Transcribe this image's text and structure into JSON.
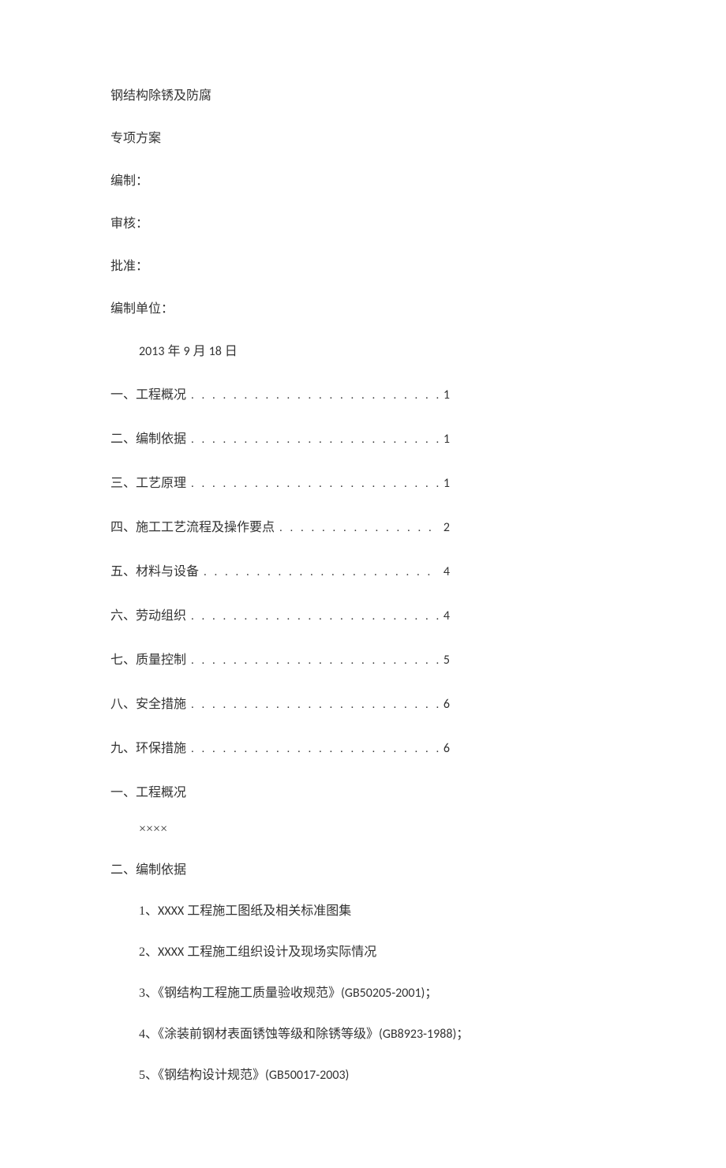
{
  "header": {
    "title": "钢结构除锈及防腐",
    "subtitle": "专项方案",
    "compiled_by_label": "编制：",
    "reviewed_by_label": "审核：",
    "approved_by_label": "批准：",
    "compiled_unit_label": "编制单位：",
    "date_year": "2013",
    "date_year_suffix": " 年 ",
    "date_month": "9",
    "date_month_suffix": " 月 ",
    "date_day": "18",
    "date_day_suffix": " 日"
  },
  "toc": [
    {
      "label": "一、工程概况",
      "page": "1"
    },
    {
      "label": "二、编制依据",
      "page": "1"
    },
    {
      "label": "三、工艺原理",
      "page": "1"
    },
    {
      "label": "四、施工工艺流程及操作要点",
      "page": "2"
    },
    {
      "label": "五、材料与设备",
      "page": "4"
    },
    {
      "label": "六、劳动组织",
      "page": "4"
    },
    {
      "label": "七、质量控制",
      "page": "5"
    },
    {
      "label": "八、安全措施",
      "page": "6"
    },
    {
      "label": "九、环保措施",
      "page": "6"
    }
  ],
  "sections": {
    "s1": {
      "head": "一、工程概况",
      "body": "××××"
    },
    "s2": {
      "head": "二、编制依据",
      "items": {
        "i1_prefix": "1、",
        "i1_latin": "XXXX",
        "i1_rest": " 工程施工图纸及相关标准图集",
        "i2_prefix": "2、",
        "i2_latin": "XXXX",
        "i2_rest": " 工程施工组织设计及现场实际情况",
        "i3_prefix": "3、《钢结构工程施工质量验收规范》",
        "i3_code": "(GB50205-2001)",
        "i3_tail": "；",
        "i4_prefix": "4、《涂装前钢材表面锈蚀等级和除锈等级》",
        "i4_code": "(GB8923-1988)",
        "i4_tail": "；",
        "i5_prefix": "5、《钢结构设计规范》",
        "i5_code": "(GB50017-2003)"
      }
    }
  }
}
